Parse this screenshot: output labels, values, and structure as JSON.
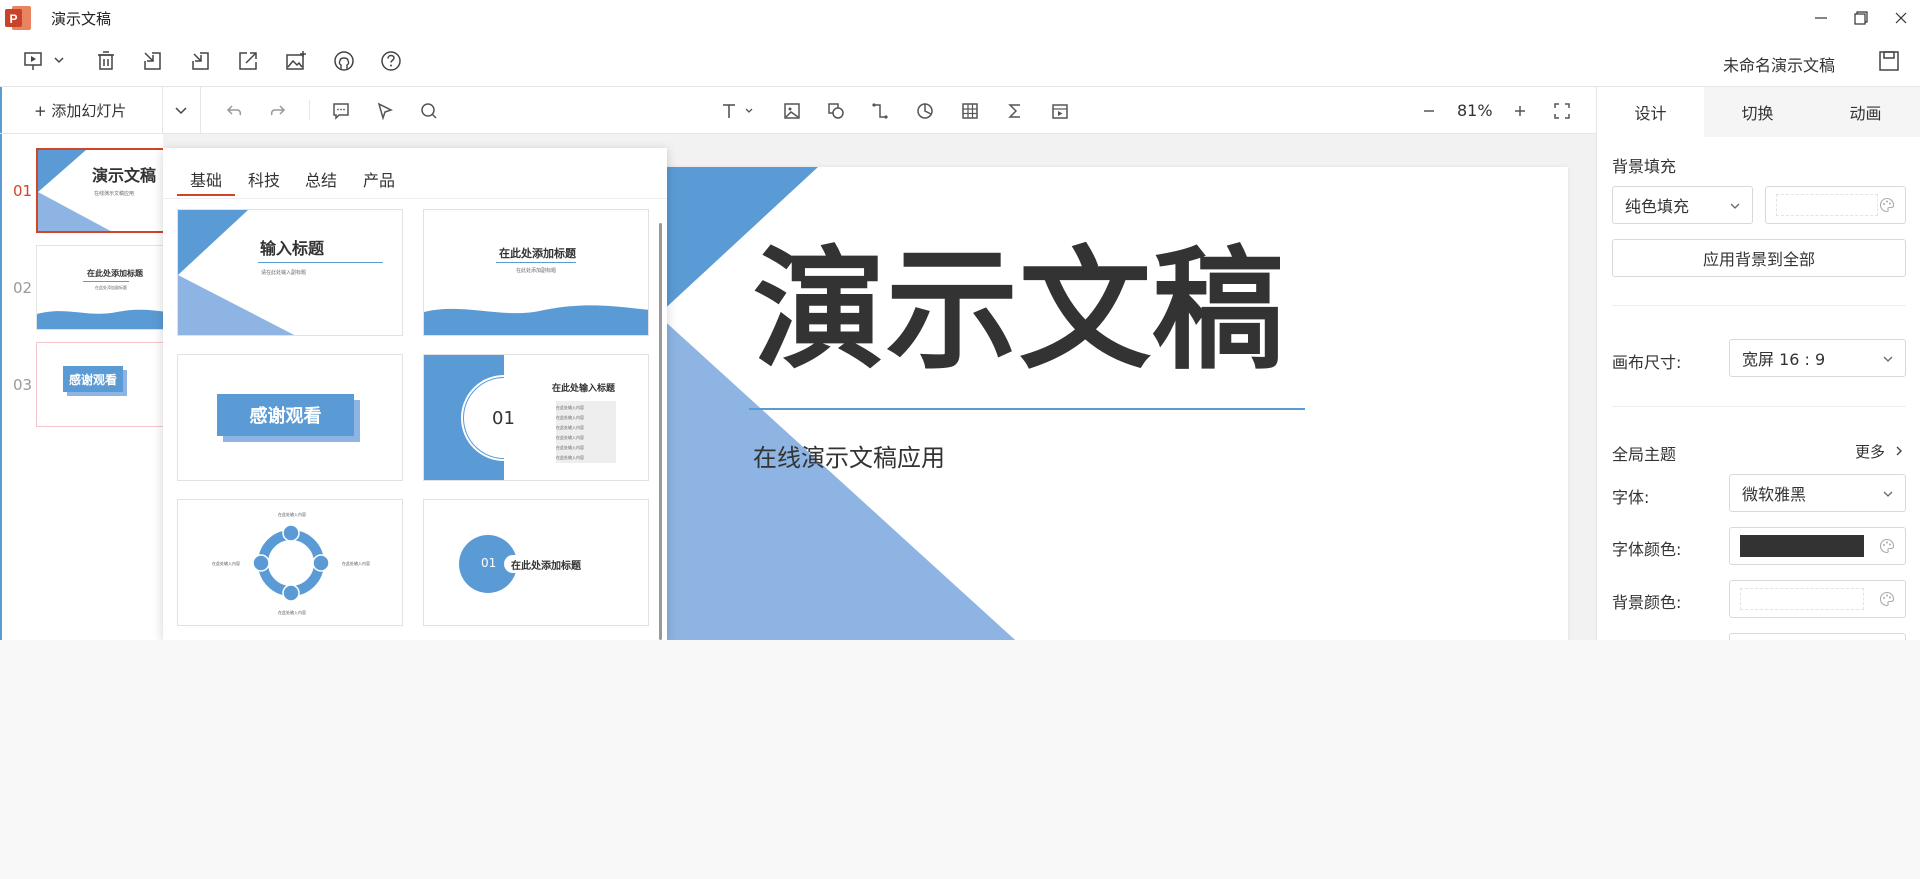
{
  "window": {
    "title": "演示文稿",
    "doc_name": "未命名演示文稿"
  },
  "thumbs_panel": {
    "add_slide_label": "+ 添加幻灯片",
    "slides": [
      {
        "num": "01",
        "title": "演示文稿",
        "subtitle": "在线演示文稿应用"
      },
      {
        "num": "02",
        "title": "在此处添加标题",
        "subtitle": "在此处添加副标题"
      },
      {
        "num": "03",
        "title": "感谢观看"
      }
    ]
  },
  "toolbar": {
    "zoom": "81%"
  },
  "template_panel": {
    "tabs": [
      "基础",
      "科技",
      "总结",
      "产品"
    ],
    "cards": {
      "c1_title": "输入标题",
      "c1_sub": "请在此处输入副标题",
      "c2_title": "在此处添加标题",
      "c2_sub": "在此处添加副标题",
      "c3_title": "感谢观看",
      "c4_num": "01",
      "c4_title": "在此处输入标题",
      "c4_item": "在此处输入内容",
      "c5_item": "在此处输入内容",
      "c6_num": "01",
      "c6_title": "在此处添加标题"
    }
  },
  "slide": {
    "title": "演示文稿",
    "subtitle": "在线演示文稿应用"
  },
  "right_panel": {
    "tabs": [
      "设计",
      "切换",
      "动画"
    ],
    "bg_fill_label": "背景填充",
    "fill_type": "纯色填充",
    "apply_all": "应用背景到全部",
    "canvas_size_label": "画布尺寸:",
    "canvas_size": "宽屏 16 : 9",
    "theme_label": "全局主题",
    "more_label": "更多",
    "font_label": "字体:",
    "font_value": "微软雅黑",
    "font_color_label": "字体颜色:",
    "font_color": "#333333",
    "bg_color_label": "背景颜色:"
  },
  "colors": {
    "accent": "#5b9bd5",
    "accent_light": "#8db4e2",
    "active_red": "#d14424"
  }
}
